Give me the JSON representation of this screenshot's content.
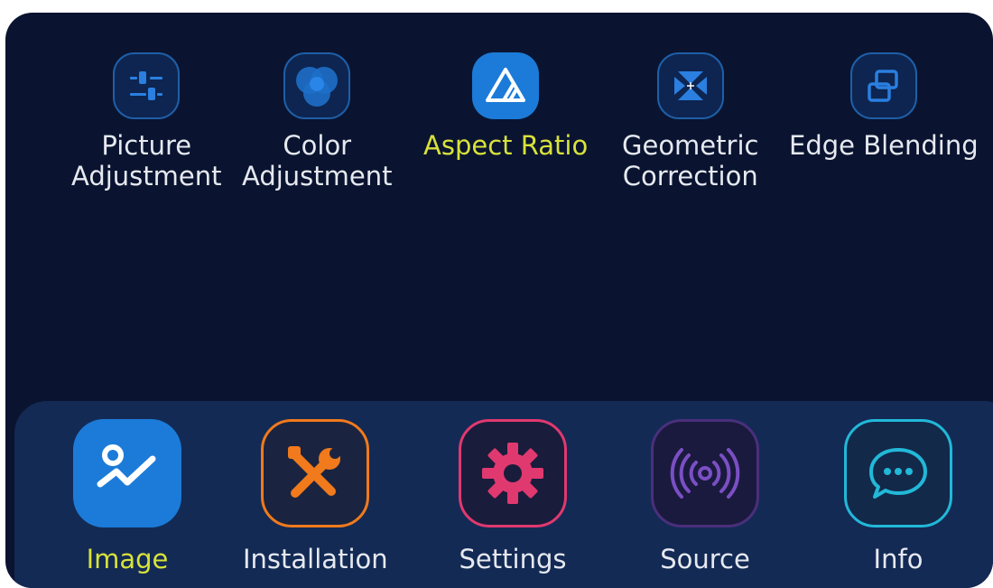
{
  "submenu": {
    "items": [
      {
        "label": "Picture\nAdjustment",
        "icon": "sliders-icon",
        "active": false
      },
      {
        "label": "Color\nAdjustment",
        "icon": "color-circles-icon",
        "active": false
      },
      {
        "label": "Aspect Ratio",
        "icon": "aspect-ratio-icon",
        "active": true
      },
      {
        "label": "Geometric\nCorrection",
        "icon": "geometric-correction-icon",
        "active": false
      },
      {
        "label": "Edge Blending",
        "icon": "edge-blending-icon",
        "active": false
      }
    ]
  },
  "nav": {
    "items": [
      {
        "label": "Image",
        "icon": "image-icon",
        "active": true,
        "color": "#1c7bd8"
      },
      {
        "label": "Installation",
        "icon": "tools-icon",
        "active": false,
        "color": "#f07a1c"
      },
      {
        "label": "Settings",
        "icon": "gear-icon",
        "active": false,
        "color": "#e0396f"
      },
      {
        "label": "Source",
        "icon": "signal-icon",
        "active": false,
        "color": "#7b4fc4"
      },
      {
        "label": "Info",
        "icon": "chat-icon",
        "active": false,
        "color": "#22b8d8"
      }
    ]
  },
  "colors": {
    "background": "#0a1430",
    "bar": "#132a55",
    "active_text": "#d8e23a",
    "text": "#e6e9f0"
  }
}
